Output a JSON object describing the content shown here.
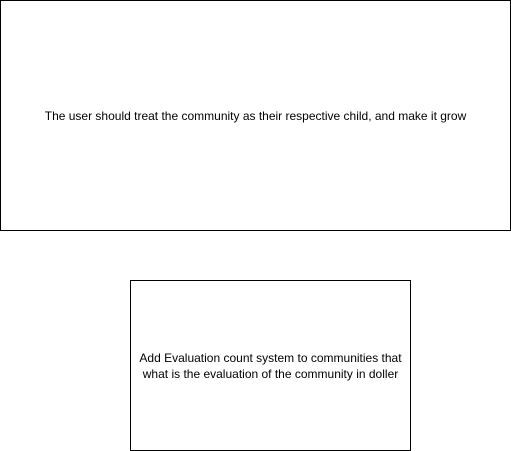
{
  "diagram": {
    "notes": [
      {
        "text": "The user should treat the community as their respective child, and make it grow"
      },
      {
        "text": "Add Evaluation count system to communities that what is the evaluation of the community in doller"
      }
    ]
  }
}
